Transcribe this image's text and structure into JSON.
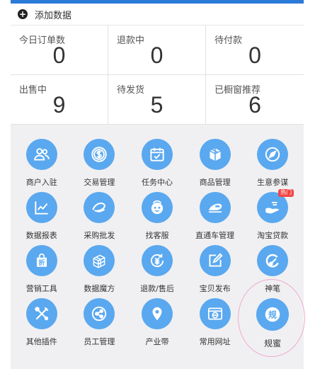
{
  "add_data": {
    "label": "添加数据"
  },
  "stats": [
    {
      "title": "今日订单数",
      "value": "0"
    },
    {
      "title": "退款中",
      "value": "0"
    },
    {
      "title": "待付款",
      "value": "0"
    },
    {
      "title": "出售中",
      "value": "9"
    },
    {
      "title": "待发货",
      "value": "5"
    },
    {
      "title": "已橱窗推荐",
      "value": "6"
    }
  ],
  "hot_badge": "热门",
  "big_icon_text": "规",
  "tools": [
    {
      "label": "商户入驻",
      "icon": "users-icon"
    },
    {
      "label": "交易管理",
      "icon": "dollar-icon"
    },
    {
      "label": "任务中心",
      "icon": "calendar-check-icon"
    },
    {
      "label": "商品管理",
      "icon": "package-icon"
    },
    {
      "label": "生意参谋",
      "icon": "compass-icon"
    },
    {
      "label": "数据报表",
      "icon": "line-chart-icon"
    },
    {
      "label": "采购批发",
      "icon": "alibaba-icon"
    },
    {
      "label": "找客服",
      "icon": "customer-service-icon"
    },
    {
      "label": "直通车管理",
      "icon": "train-icon"
    },
    {
      "label": "淘宝贷款",
      "icon": "hand-money-icon"
    },
    {
      "label": "营销工具",
      "icon": "discount-bag-icon"
    },
    {
      "label": "数据魔方",
      "icon": "cube-grid-icon"
    },
    {
      "label": "退款/售后",
      "icon": "refund-icon"
    },
    {
      "label": "宝贝发布",
      "icon": "edit-icon"
    },
    {
      "label": "神笔",
      "icon": "brush-icon"
    },
    {
      "label": "其他插件",
      "icon": "tools-icon"
    },
    {
      "label": "员工管理",
      "icon": "share-nodes-icon"
    },
    {
      "label": "产业带",
      "icon": "location-pin-icon"
    },
    {
      "label": "常用网址",
      "icon": "browser-icon"
    },
    {
      "label": "规蜜",
      "icon": "guimi-icon"
    }
  ],
  "colors": {
    "accent": "#2b7ad8",
    "icon_bg": "#5aa8ef",
    "grid_bg": "#f0f0f2",
    "hot": "#f14545",
    "ring": "#f1aad0"
  }
}
